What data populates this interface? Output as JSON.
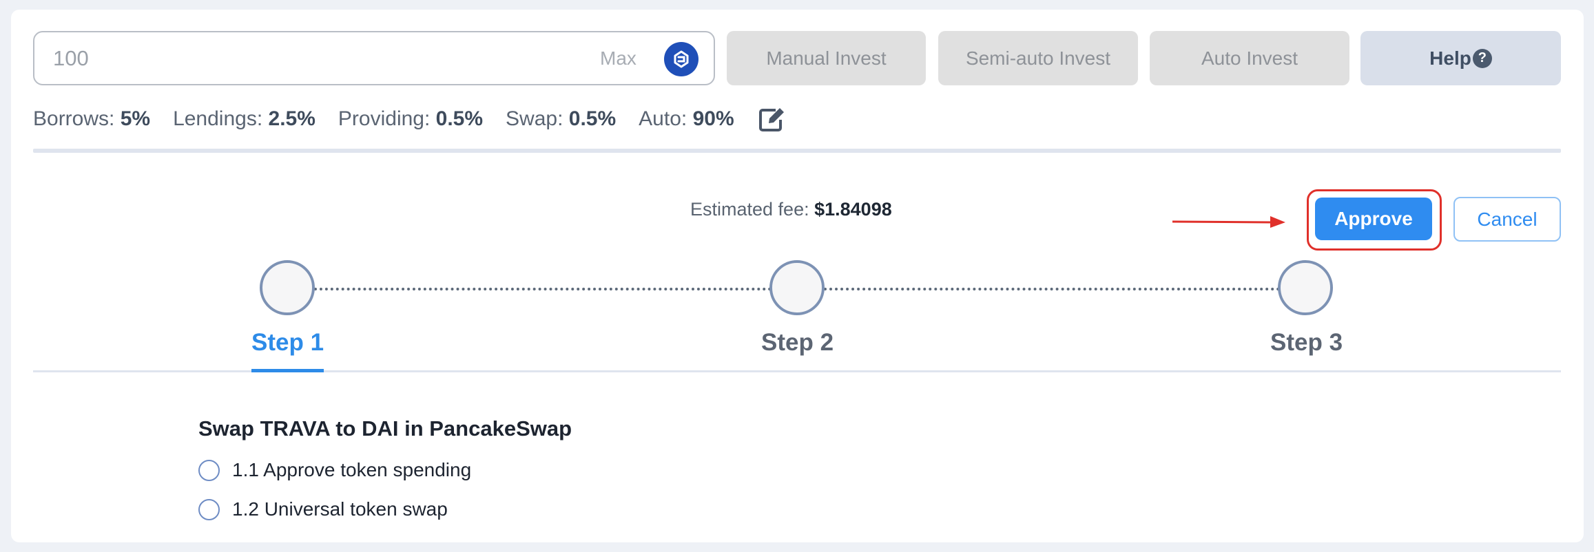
{
  "toolbar": {
    "amount_value": "100",
    "max_label": "Max",
    "token_icon": "trava-token-icon",
    "manual_invest": "Manual Invest",
    "semi_auto_invest": "Semi-auto Invest",
    "auto_invest": "Auto Invest",
    "help": "Help",
    "help_icon_glyph": "?"
  },
  "rates": [
    {
      "label": "Borrows:",
      "value": "5%"
    },
    {
      "label": "Lendings:",
      "value": "2.5%"
    },
    {
      "label": "Providing:",
      "value": "0.5%"
    },
    {
      "label": "Swap:",
      "value": "0.5%"
    },
    {
      "label": "Auto:",
      "value": "90%"
    }
  ],
  "fee": {
    "label": "Estimated fee:",
    "value": "$1.84098"
  },
  "actions": {
    "approve": "Approve",
    "cancel": "Cancel"
  },
  "steps": [
    {
      "label": "Step 1",
      "active": true
    },
    {
      "label": "Step 2",
      "active": false
    },
    {
      "label": "Step 3",
      "active": false
    }
  ],
  "task": {
    "title": "Swap TRAVA to DAI in PancakeSwap",
    "items": [
      {
        "label": "1.1 Approve token spending",
        "checked": false
      },
      {
        "label": "1.2 Universal token swap",
        "checked": false
      }
    ]
  },
  "colors": {
    "accent": "#2d8be8",
    "highlight": "#e0302a",
    "token": "#1f4fb8"
  }
}
